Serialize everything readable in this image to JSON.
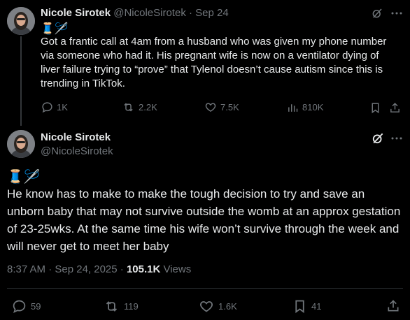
{
  "reply_tweet": {
    "name": "Nicole Sirotek",
    "handle": "@NicoleSirotek",
    "separator": "·",
    "date": "Sep 24",
    "emoji": "🧵🪡",
    "text": "Got a frantic call at 4am from a husband who was given my phone number via someone who had it. His pregnant wife is now on a ventilator dying of liver failure trying to “prove” that Tylenol doesn’t cause autism since this is trending in TikTok.",
    "stats": {
      "replies": "1K",
      "reposts": "2.2K",
      "likes": "7.5K",
      "views": "810K"
    }
  },
  "main_tweet": {
    "name": "Nicole Sirotek",
    "handle": "@NicoleSirotek",
    "emoji": "🧵🪡",
    "text": "He know has to make to make the tough decision to try and save an unborn baby that may not survive outside the womb at an approx gestation of 23-25wks. At the same time his wife won’t survive through the week and will never get to meet her baby",
    "time": "8:37 AM · Sep 24, 2025 · ",
    "views_count": "105.1K",
    "views_label": " Views",
    "stats": {
      "replies": "59",
      "reposts": "119",
      "likes": "1.6K",
      "bookmarks": "41"
    }
  },
  "icons": [
    "grok-icon",
    "more-icon",
    "reply-icon",
    "repost-icon",
    "like-icon",
    "views-icon",
    "bookmark-icon",
    "share-icon"
  ],
  "colors": {
    "background": "#000000",
    "text": "#e7e9ea",
    "muted": "#71767b",
    "divider": "#2f3336"
  }
}
